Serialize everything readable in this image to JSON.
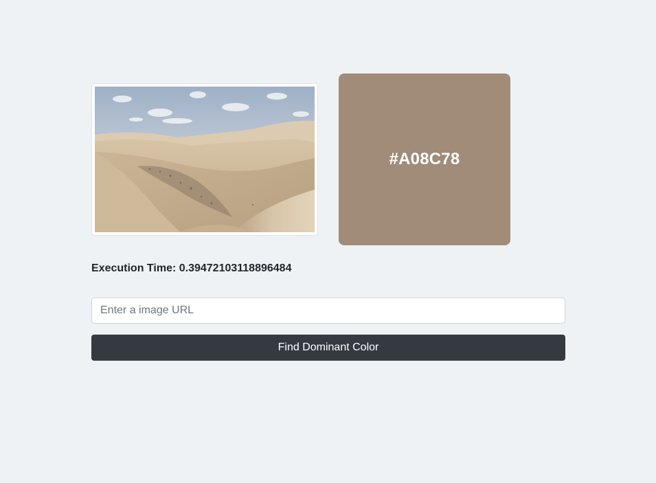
{
  "result": {
    "dominant_color_label": "#A08C78",
    "dominant_color_hex": "#A08C78",
    "execution_time_text": "Execution Time: 0.39472103118896484"
  },
  "preview": {
    "alt": "desert sand dunes"
  },
  "form": {
    "url_value": "",
    "url_placeholder": "Enter a image URL",
    "submit_label": "Find Dominant Color"
  },
  "colors": {
    "page_background": "#eff2f4",
    "button_background": "#343a40",
    "button_text": "#ffffff"
  }
}
